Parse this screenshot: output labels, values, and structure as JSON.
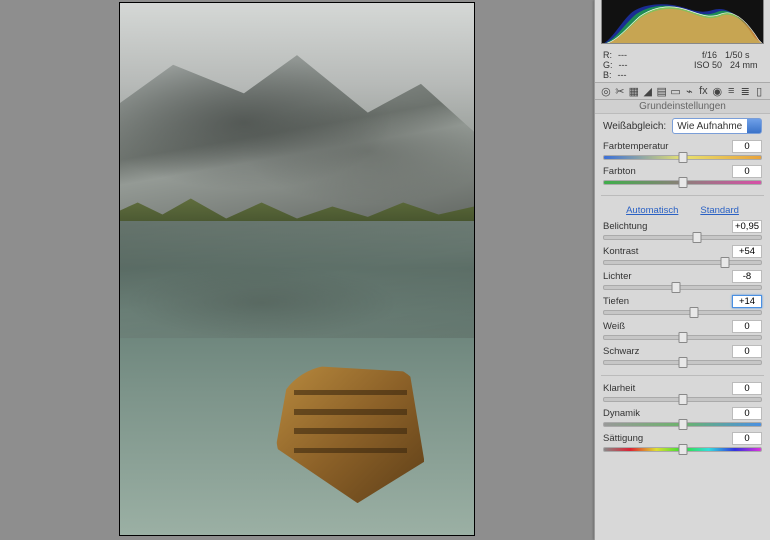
{
  "meta": {
    "r_label": "R:",
    "r_val": "---",
    "g_label": "G:",
    "g_val": "---",
    "b_label": "B:",
    "b_val": "---",
    "aperture": "f/16",
    "shutter": "1/50 s",
    "iso": "ISO 50",
    "focal": "24 mm"
  },
  "section_title": "Grundeinstellungen",
  "wb": {
    "label": "Weißabgleich:",
    "value": "Wie Aufnahme"
  },
  "links": {
    "auto": "Automatisch",
    "default": "Standard"
  },
  "sliders": {
    "temp": {
      "label": "Farbtemperatur",
      "value": "0",
      "pos": 50
    },
    "tint": {
      "label": "Farbton",
      "value": "0",
      "pos": 50
    },
    "exposure": {
      "label": "Belichtung",
      "value": "+0,95",
      "pos": 59
    },
    "contrast": {
      "label": "Kontrast",
      "value": "+54",
      "pos": 77
    },
    "highlights": {
      "label": "Lichter",
      "value": "-8",
      "pos": 46
    },
    "shadows": {
      "label": "Tiefen",
      "value": "+14",
      "pos": 57,
      "hl": true
    },
    "whites": {
      "label": "Weiß",
      "value": "0",
      "pos": 50
    },
    "blacks": {
      "label": "Schwarz",
      "value": "0",
      "pos": 50
    },
    "clarity": {
      "label": "Klarheit",
      "value": "0",
      "pos": 50
    },
    "vibrance": {
      "label": "Dynamik",
      "value": "0",
      "pos": 50
    },
    "saturation": {
      "label": "Sättigung",
      "value": "0",
      "pos": 50
    }
  },
  "tool_icons": [
    "◎",
    "✂",
    "▦",
    "◢",
    "▤",
    "▭",
    "⌁",
    "fx",
    "◉",
    "≡",
    "≣",
    "▯"
  ]
}
